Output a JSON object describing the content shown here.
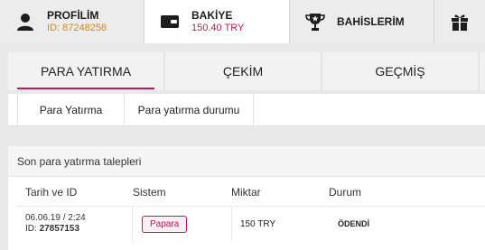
{
  "topnav": {
    "profile": {
      "title": "PROFİLİM",
      "sub": "ID: 87248258"
    },
    "balance": {
      "title": "BAKİYE",
      "sub": "150.40 TRY"
    },
    "bets": {
      "title": "BAHİSLERİM"
    },
    "gifts": {
      "title": ""
    }
  },
  "tabs": {
    "deposit": "PARA YATIRMA",
    "withdraw": "ÇEKİM",
    "history": "GEÇMİŞ"
  },
  "subtabs": {
    "deposit": "Para Yatırma",
    "deposit_status": "Para yatırma durumu"
  },
  "requests": {
    "title": "Son para yatırma talepleri",
    "columns": {
      "date": "Tarih ve ID",
      "system": "Sistem",
      "amount": "Miktar",
      "status": "Durum"
    },
    "rows": [
      {
        "date": "06.06.19 / 2:24",
        "id_label": "ID:",
        "id": "27857153",
        "system": "Papara",
        "amount": "150 TRY",
        "status": "ÖDENDİ"
      }
    ]
  },
  "colors": {
    "accent": "#c2185b",
    "id_orange": "#d28a17"
  },
  "icons": [
    "user-icon",
    "wallet-icon",
    "trophy-icon",
    "gift-icon"
  ]
}
